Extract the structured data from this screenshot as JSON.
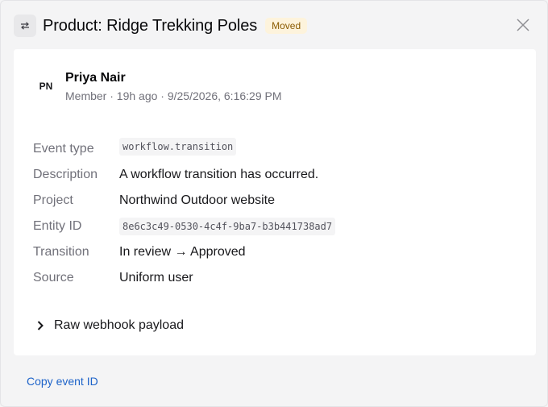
{
  "header": {
    "title": "Product: Ridge Trekking Poles",
    "badge": "Moved",
    "icons": {
      "type": "swap-arrows-icon",
      "close": "close-icon"
    }
  },
  "author": {
    "initials": "PN",
    "name": "Priya Nair",
    "meta": "Member · 19h ago · 9/25/2026, 6:16:29 PM"
  },
  "details": [
    {
      "label": "Event type",
      "value": "workflow.transition",
      "code": true
    },
    {
      "label": "Description",
      "value": "A workflow transition has occurred.",
      "code": false
    },
    {
      "label": "Project",
      "value": "Northwind Outdoor website",
      "code": false
    },
    {
      "label": "Entity ID",
      "value": "8e6c3c49-0530-4c4f-9ba7-b3b441738ad7",
      "code": true
    },
    {
      "label": "Transition",
      "value": "In review → Approved",
      "code": false
    },
    {
      "label": "Source",
      "value": "Uniform user",
      "code": false
    }
  ],
  "payload": {
    "label": "Raw webhook payload",
    "icon": "chevron-right-icon"
  },
  "footer": {
    "copy_label": "Copy event ID"
  },
  "colors": {
    "link": "#1d63c9",
    "badge_bg": "#fdf3dc",
    "badge_text": "#8a5a00"
  }
}
